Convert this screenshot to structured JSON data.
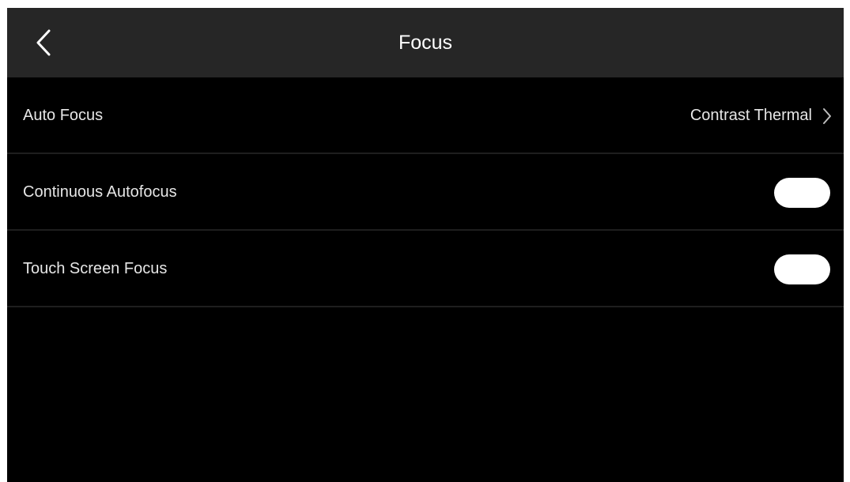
{
  "header": {
    "title": "Focus",
    "back_icon": "chevron-left-icon"
  },
  "settings": [
    {
      "label": "Auto Focus",
      "value": "Contrast Thermal",
      "control": "disclosure",
      "icon": "chevron-right-icon"
    },
    {
      "label": "Continuous Autofocus",
      "control": "toggle",
      "state": "off"
    },
    {
      "label": "Touch Screen Focus",
      "control": "toggle",
      "state": "off"
    }
  ],
  "colors": {
    "header_bg": "#262626",
    "screen_bg": "#000000",
    "text": "#e6e6e6",
    "toggle_fill": "#ffffff",
    "divider": "#1e1e1e"
  }
}
